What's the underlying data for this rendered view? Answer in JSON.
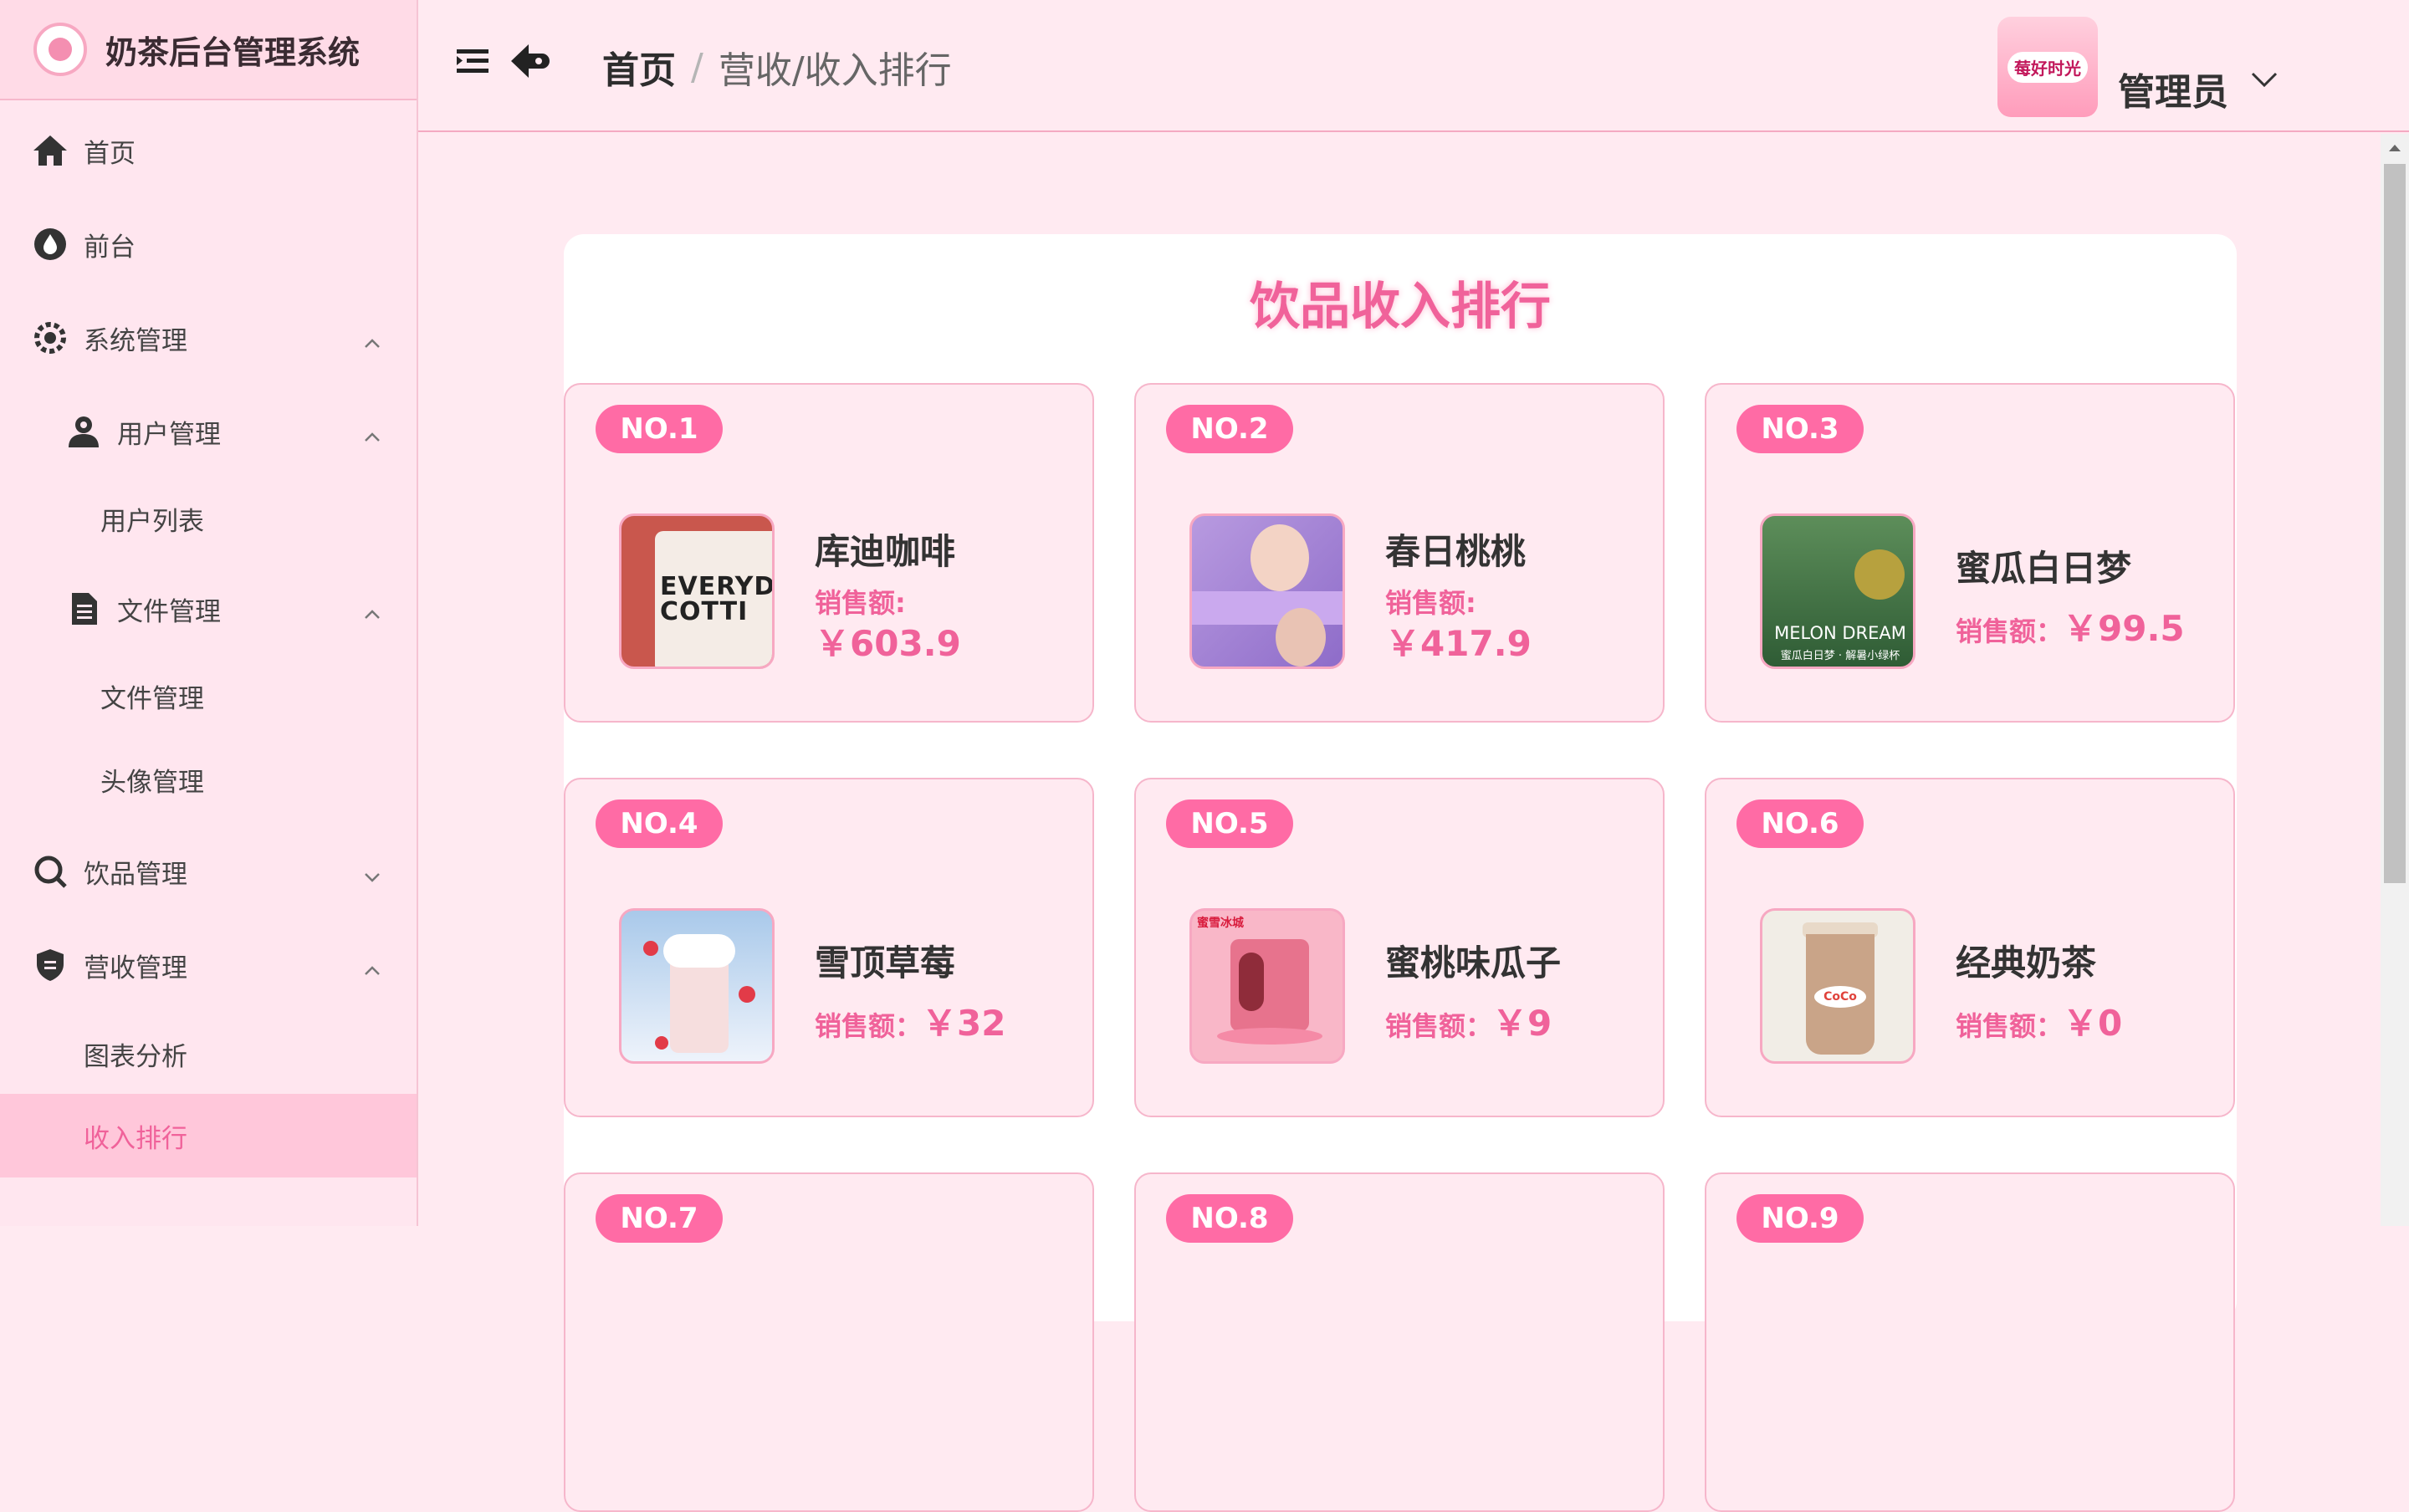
{
  "app": {
    "title": "奶茶后台管理系统"
  },
  "sidebar": {
    "items": [
      {
        "label": "首页",
        "icon": "home-icon"
      },
      {
        "label": "前台",
        "icon": "drop-icon"
      },
      {
        "label": "系统管理",
        "icon": "gear-icon"
      },
      {
        "label": "用户管理",
        "icon": "user-icon"
      },
      {
        "label": "用户列表"
      },
      {
        "label": "文件管理",
        "icon": "file-icon"
      },
      {
        "label": "文件管理"
      },
      {
        "label": "头像管理"
      },
      {
        "label": "饮品管理",
        "icon": "search-icon"
      },
      {
        "label": "营收管理",
        "icon": "shield-icon"
      },
      {
        "label": "图表分析"
      },
      {
        "label": "收入排行"
      }
    ]
  },
  "header": {
    "breadcrumb_home": "首页",
    "breadcrumb_sep": "/",
    "breadcrumb_current": "营收/收入排行",
    "avatar_text": "莓好时光",
    "user_name": "管理员"
  },
  "ranking": {
    "title": "饮品收入排行",
    "sales_label": "销售额：",
    "items": [
      {
        "rank": "NO.1",
        "name": "库迪咖啡",
        "sales_label": "销售额:",
        "amount": "￥603.9",
        "thumb_text": "EVERYDAY COTTI"
      },
      {
        "rank": "NO.2",
        "name": "春日桃桃",
        "sales_label": "销售额:",
        "amount": "￥417.9",
        "thumb_text": ""
      },
      {
        "rank": "NO.3",
        "name": "蜜瓜白日梦",
        "sales_label": "销售额：",
        "amount": "￥99.5",
        "thumb_text": "MELON DREAM",
        "thumb_sub": "蜜瓜白日梦 · 解暑小绿杯"
      },
      {
        "rank": "NO.4",
        "name": "雪顶草莓",
        "sales_label": "销售额：",
        "amount": "￥32",
        "thumb_text": ""
      },
      {
        "rank": "NO.5",
        "name": "蜜桃味瓜子",
        "sales_label": "销售额：",
        "amount": "￥9",
        "thumb_text": "蜜雪冰城"
      },
      {
        "rank": "NO.6",
        "name": "经典奶茶",
        "sales_label": "销售额：",
        "amount": "￥0",
        "thumb_text": "CoCo"
      },
      {
        "rank": "NO.7"
      },
      {
        "rank": "NO.8"
      },
      {
        "rank": "NO.9"
      }
    ]
  },
  "colors": {
    "accent": "#f0629a",
    "badge": "#ff6ba5",
    "sidebar_active": "#ffc7da",
    "background": "#ffeaf1"
  }
}
